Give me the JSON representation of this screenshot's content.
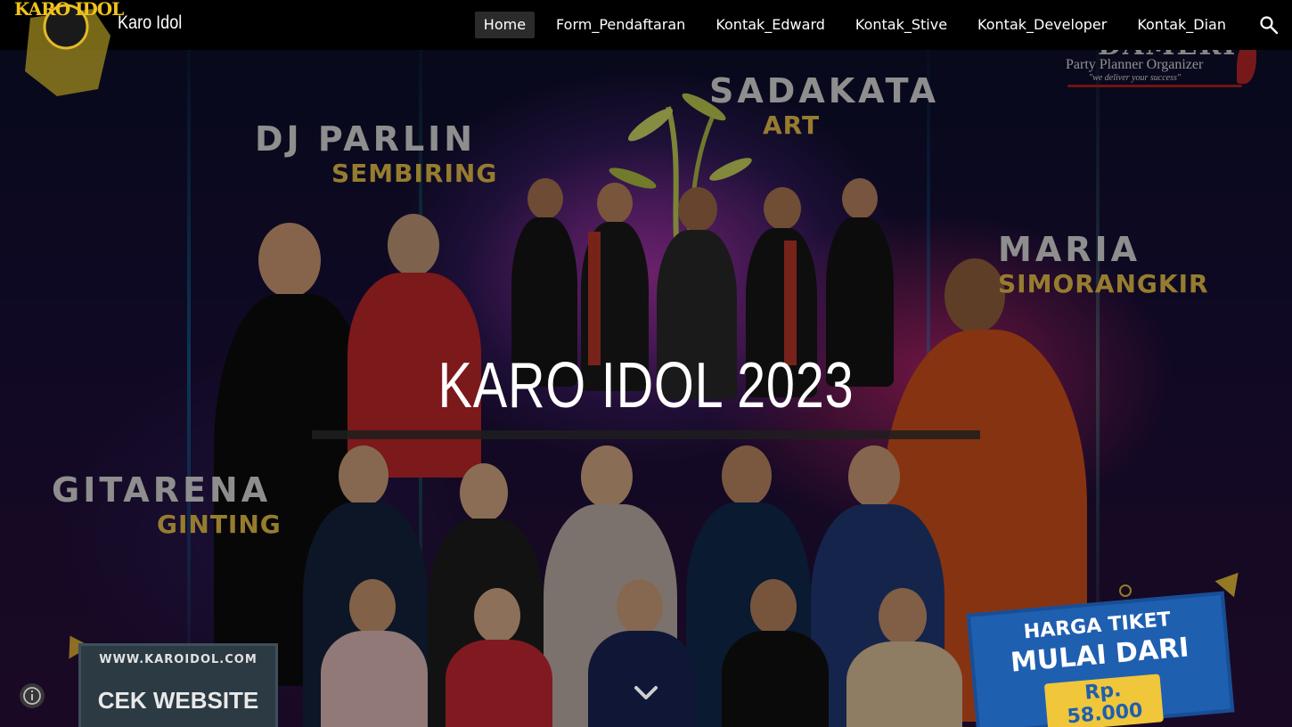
{
  "site": {
    "title": "Karo Idol",
    "logo_text": "KARO IDOL"
  },
  "nav": {
    "items": [
      {
        "label": "Home",
        "active": true
      },
      {
        "label": "Form_Pendaftaran",
        "active": false
      },
      {
        "label": "Kontak_Edward",
        "active": false
      },
      {
        "label": "Kontak_Stive",
        "active": false
      },
      {
        "label": "Kontak_Developer",
        "active": false
      },
      {
        "label": "Kontak_Dian",
        "active": false
      }
    ],
    "search_icon": "search-icon"
  },
  "hero": {
    "title": "KARO IDOL 2023",
    "overlay_color": "#000000"
  },
  "poster": {
    "sponsor": {
      "name": "DAMERI",
      "tagline": "Party Planner Organizer",
      "slogan": "\"we deliver your success\""
    },
    "artists": [
      {
        "first": "DJ PARLIN",
        "last": "SEMBIRING"
      },
      {
        "first": "SADAKATA",
        "last": "ART"
      },
      {
        "first": "MARIA",
        "last": "SIMORANGKIR"
      },
      {
        "first": "GITARENA",
        "last": "GINTING"
      }
    ],
    "website": {
      "url": "WWW.KAROIDOL.COM",
      "cta": "CEK WEBSITE"
    },
    "ticket": {
      "line1": "HARGA TIKET",
      "line2": "MULAI DARI",
      "price": "Rp. 58.000"
    }
  },
  "icons": {
    "scroll": "chevron-down-icon",
    "info": "info-icon"
  },
  "colors": {
    "topbar": "#000000",
    "accent_gold": "#f2c94c",
    "ticket_blue": "#1f5fb0"
  }
}
